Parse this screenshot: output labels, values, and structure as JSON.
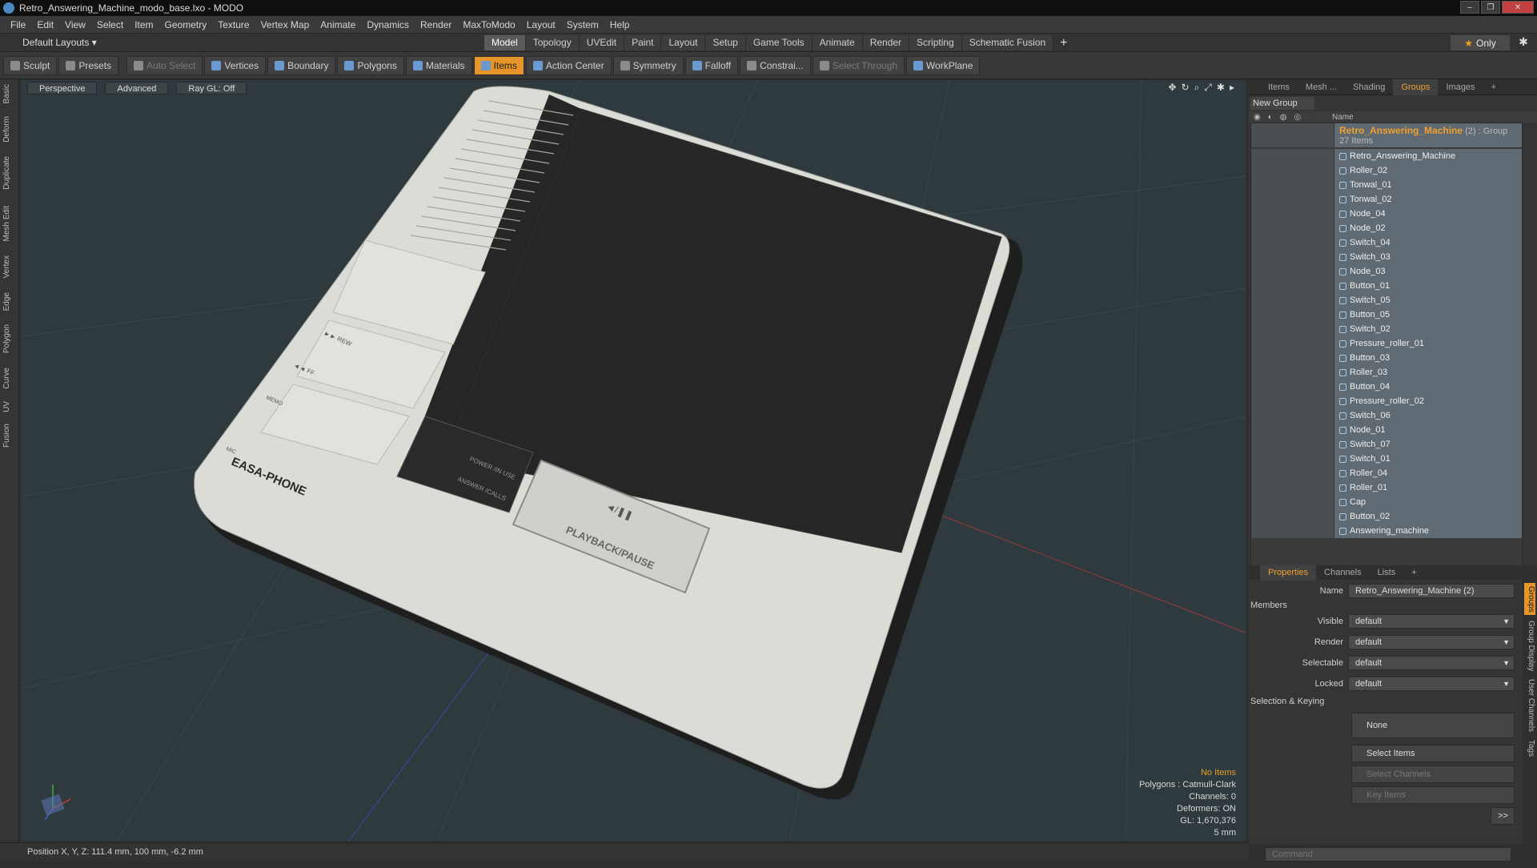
{
  "window": {
    "title": "Retro_Answering_Machine_modo_base.lxo - MODO",
    "min": "‒",
    "max": "❐",
    "close": "✕"
  },
  "menu": [
    "File",
    "Edit",
    "View",
    "Select",
    "Item",
    "Geometry",
    "Texture",
    "Vertex Map",
    "Animate",
    "Dynamics",
    "Render",
    "MaxToModo",
    "Layout",
    "System",
    "Help"
  ],
  "layouts": {
    "current": "Default Layouts ▾",
    "tabs": [
      "Model",
      "Topology",
      "UVEdit",
      "Paint",
      "Layout",
      "Setup",
      "Game Tools",
      "Animate",
      "Render",
      "Scripting",
      "Schematic Fusion"
    ],
    "active_tab": "Model",
    "plus": "+",
    "only": "Only",
    "star": "★",
    "gear": "✱"
  },
  "toolbar": {
    "sculpt": "Sculpt",
    "presets": "Presets",
    "auto_select": "Auto Select",
    "vertices": "Vertices",
    "boundary": "Boundary",
    "polygons": "Polygons",
    "materials": "Materials",
    "items": "Items",
    "action_center": "Action Center",
    "symmetry": "Symmetry",
    "falloff": "Falloff",
    "constrain": "Constrai...",
    "select_through": "Select Through",
    "workplane": "WorkPlane"
  },
  "left_tabs": [
    "Basic",
    "Deform",
    "Duplicate",
    "Mesh Edit",
    "Vertex",
    "Edge",
    "Polygon",
    "Curve",
    "UV",
    "Fusion"
  ],
  "viewport": {
    "view": "Perspective",
    "shading": "Advanced",
    "raygl": "Ray GL: Off",
    "icons": [
      "✥",
      "↻",
      "⌕",
      "⤢",
      "✱",
      "▸"
    ],
    "info": {
      "selection": "No Items",
      "polygons": "Polygons : Catmull-Clark",
      "channels": "Channels: 0",
      "deformers": "Deformers: ON",
      "gl": "GL: 1,670,376",
      "grid": "5 mm"
    },
    "device": {
      "brand": "EASA-PHONE",
      "mic": "MIC",
      "rew": "►► REW",
      "ff": "◄◄ FF",
      "memo": "MEMO",
      "power": "POWER /IN USE",
      "answer": "ANSWER /CALLS",
      "play_icon": "◄/❚❚",
      "playback": "PLAYBACK/PAUSE"
    }
  },
  "status": {
    "position": "Position X, Y, Z:  111.4 mm, 100 mm, -6.2 mm"
  },
  "panel_tabs": [
    "Items",
    "Mesh ...",
    "Shading",
    "Groups",
    "Images",
    "+"
  ],
  "panel_active": "Groups",
  "new_group": "New Group",
  "list_header": "Name",
  "group": {
    "name": "Retro_Answering_Machine",
    "suffix": "(2) : Group",
    "count": "27 Items"
  },
  "items": [
    "Retro_Answering_Machine",
    "Roller_02",
    "Tonwal_01",
    "Tonwal_02",
    "Node_04",
    "Node_02",
    "Switch_04",
    "Switch_03",
    "Node_03",
    "Button_01",
    "Switch_05",
    "Button_05",
    "Switch_02",
    "Pressure_roller_01",
    "Button_03",
    "Roller_03",
    "Button_04",
    "Pressure_roller_02",
    "Switch_06",
    "Node_01",
    "Switch_07",
    "Switch_01",
    "Roller_04",
    "Roller_01",
    "Cap",
    "Button_02",
    "Answering_machine"
  ],
  "prop_tabs": [
    "Properties",
    "Channels",
    "Lists",
    "+"
  ],
  "prop_active": "Properties",
  "props": {
    "name_label": "Name",
    "name_value": "Retro_Answering_Machine (2)",
    "members": "Members",
    "visible_label": "Visible",
    "visible_value": "default",
    "render_label": "Render",
    "render_value": "default",
    "selectable_label": "Selectable",
    "selectable_value": "default",
    "locked_label": "Locked",
    "locked_value": "default",
    "sel_keying": "Selection & Keying",
    "none": "None",
    "select_items": "Select Items",
    "select_channels": "Select Channels",
    "key_items": "Key Items",
    "more": ">>"
  },
  "side_tabs": [
    "Groups",
    "Group Display",
    "User Channels",
    "Tags"
  ],
  "command_placeholder": "Command",
  "colors": {
    "accent": "#e5952a",
    "viewport_bg": "#2f3a3e",
    "selected_row": "#5f6a73"
  }
}
